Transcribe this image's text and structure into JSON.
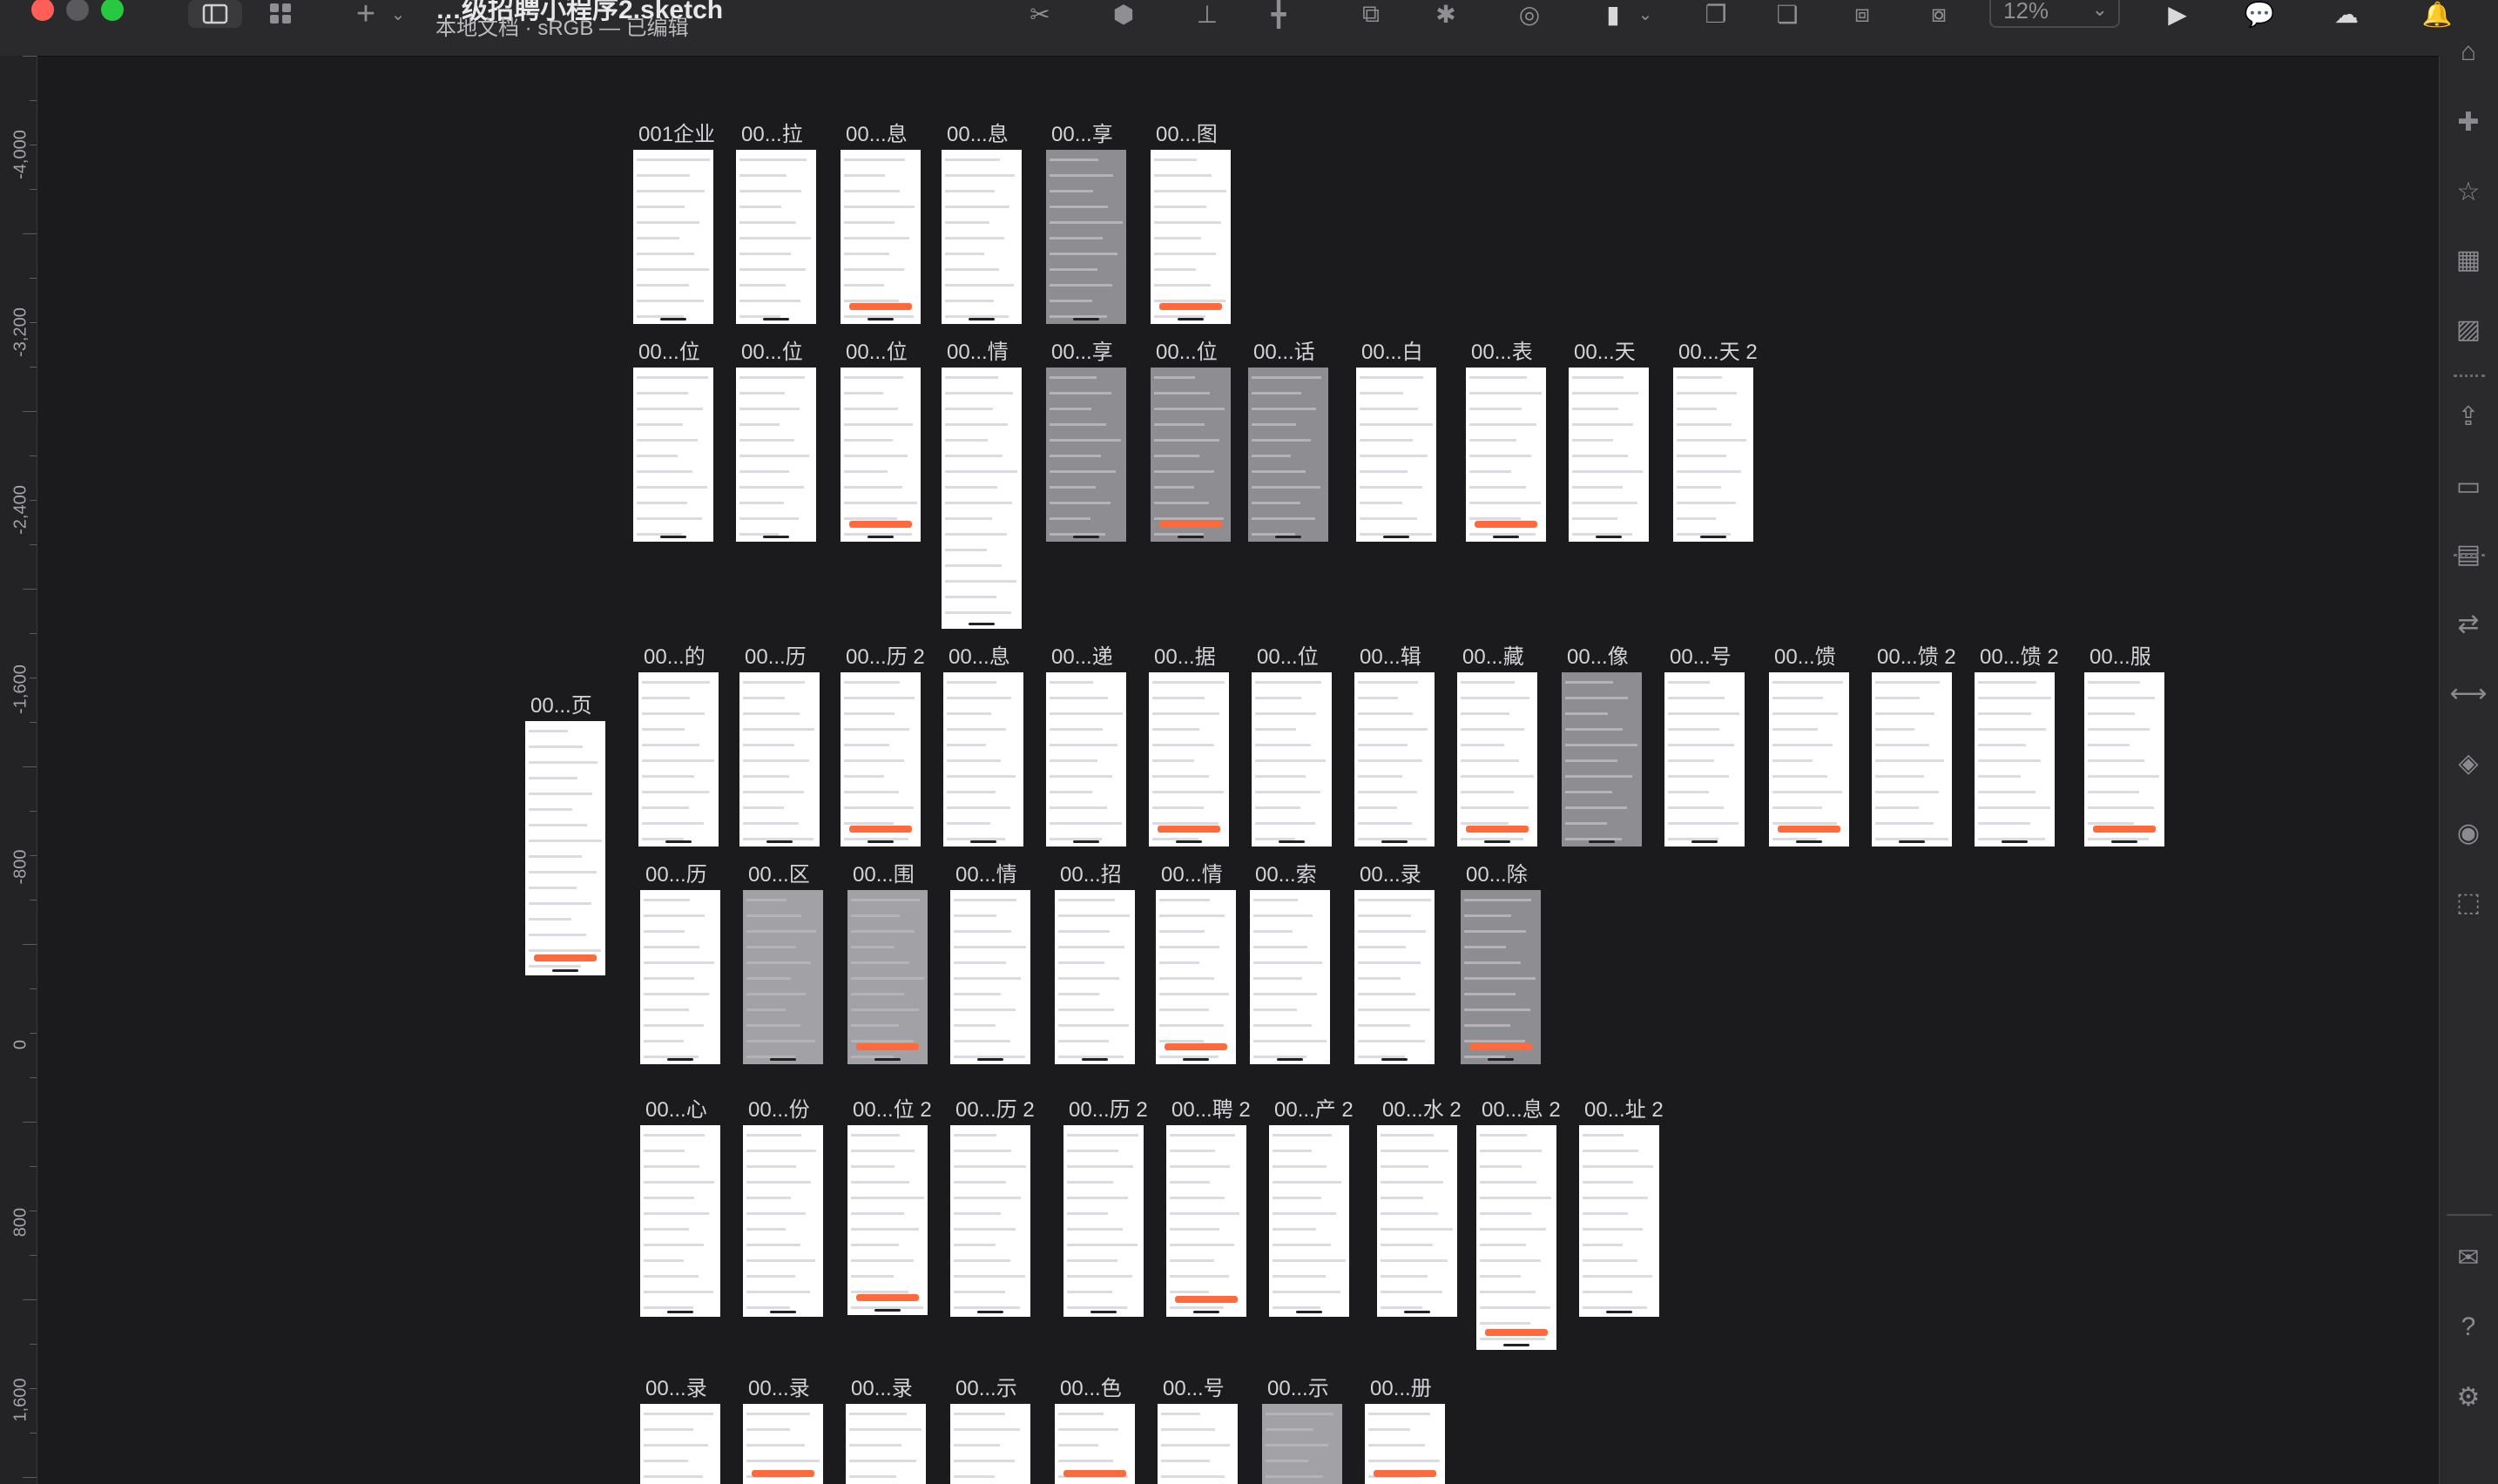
{
  "window": {
    "title": "…级招聘小程序2.sketch",
    "subtitle": "本地文档 · sRGB — 已编辑",
    "zoom_label": "12%"
  },
  "toolbar_icons": [
    "sidebar-toggle-icon",
    "component-grid-icon",
    "insert-icon",
    "chevron-down-icon",
    "scissors-icon",
    "mask-icon",
    "align-icon",
    "distribute-icon",
    "resize-icon",
    "boolean-icon",
    "rotate-icon",
    "flatten-icon",
    "union-icon",
    "subtract-icon",
    "intersect-icon",
    "difference-icon",
    "play-icon",
    "comment-icon",
    "cloud-icon",
    "notification-icon"
  ],
  "ruler_labels": [
    "-4,000",
    "-3,200",
    "-2,400",
    "-1,600",
    "-800",
    "0",
    "800",
    "1,600"
  ],
  "sidebar_icons": [
    "store-icon",
    "puzzle-icon",
    "star-frame-icon",
    "grid-icon",
    "image-icon",
    "export-icon",
    "layout-icon",
    "chart-icon",
    "transfer-icon",
    "resize-horizontal-icon",
    "layers-icon",
    "navigation-icon",
    "export-image-icon",
    "mail-icon",
    "help-icon",
    "settings-icon"
  ],
  "artboards": [
    {
      "name": "001企业",
      "shade": "light",
      "row": 0
    },
    {
      "name": "00...拉",
      "shade": "light",
      "row": 0
    },
    {
      "name": "00...息",
      "shade": "light",
      "row": 0
    },
    {
      "name": "00...息",
      "shade": "light",
      "row": 0
    },
    {
      "name": "00...享",
      "shade": "dark",
      "row": 0
    },
    {
      "name": "00...图",
      "shade": "light",
      "row": 0
    },
    {
      "name": "00...位",
      "shade": "light",
      "row": 1
    },
    {
      "name": "00...位",
      "shade": "light",
      "row": 1
    },
    {
      "name": "00...位",
      "shade": "light",
      "row": 1
    },
    {
      "name": "00...情",
      "shade": "light",
      "row": 1
    },
    {
      "name": "00...享",
      "shade": "dark",
      "row": 1
    },
    {
      "name": "00...位",
      "shade": "dark",
      "row": 1
    },
    {
      "name": "00...话",
      "shade": "dark",
      "row": 1
    },
    {
      "name": "00...白",
      "shade": "light",
      "row": 1
    },
    {
      "name": "00...表",
      "shade": "light",
      "row": 1
    },
    {
      "name": "00...天",
      "shade": "light",
      "row": 1
    },
    {
      "name": "00...天 2",
      "shade": "light",
      "row": 1
    },
    {
      "name": "00...页",
      "shade": "light",
      "row": 2
    },
    {
      "name": "00...的",
      "shade": "light",
      "row": 3
    },
    {
      "name": "00...历",
      "shade": "light",
      "row": 3
    },
    {
      "name": "00...历 2",
      "shade": "light",
      "row": 3
    },
    {
      "name": "00...息",
      "shade": "light",
      "row": 3
    },
    {
      "name": "00...递",
      "shade": "light",
      "row": 3
    },
    {
      "name": "00...据",
      "shade": "light",
      "row": 3
    },
    {
      "name": "00...位",
      "shade": "light",
      "row": 3
    },
    {
      "name": "00...辑",
      "shade": "light",
      "row": 3
    },
    {
      "name": "00...藏",
      "shade": "light",
      "row": 3
    },
    {
      "name": "00...像",
      "shade": "dark",
      "row": 3
    },
    {
      "name": "00...号",
      "shade": "light",
      "row": 3
    },
    {
      "name": "00...馈",
      "shade": "light",
      "row": 3
    },
    {
      "name": "00...馈 2",
      "shade": "light",
      "row": 3
    },
    {
      "name": "00...馈 2",
      "shade": "light",
      "row": 3
    },
    {
      "name": "00...服",
      "shade": "light",
      "row": 3
    },
    {
      "name": "00...历",
      "shade": "light",
      "row": 4
    },
    {
      "name": "00...区",
      "shade": "gray",
      "row": 4
    },
    {
      "name": "00...围",
      "shade": "gray",
      "row": 4
    },
    {
      "name": "00...情",
      "shade": "light",
      "row": 4
    },
    {
      "name": "00...招",
      "shade": "light",
      "row": 4
    },
    {
      "name": "00...情",
      "shade": "light",
      "row": 4
    },
    {
      "name": "00...索",
      "shade": "light",
      "row": 4
    },
    {
      "name": "00...录",
      "shade": "light",
      "row": 4
    },
    {
      "name": "00...除",
      "shade": "dark",
      "row": 4
    },
    {
      "name": "00...心",
      "shade": "light",
      "row": 5
    },
    {
      "name": "00...份",
      "shade": "light",
      "row": 5
    },
    {
      "name": "00...位 2",
      "shade": "light",
      "row": 5
    },
    {
      "name": "00...历 2",
      "shade": "light",
      "row": 5
    },
    {
      "name": "00...历 2",
      "shade": "light",
      "row": 5
    },
    {
      "name": "00...聘 2",
      "shade": "light",
      "row": 5
    },
    {
      "name": "00...产 2",
      "shade": "light",
      "row": 5
    },
    {
      "name": "00...水 2",
      "shade": "light",
      "row": 5
    },
    {
      "name": "00...息 2",
      "shade": "light",
      "row": 5
    },
    {
      "name": "00...址 2",
      "shade": "light",
      "row": 5
    },
    {
      "name": "00...录",
      "shade": "light",
      "row": 6
    },
    {
      "name": "00...录",
      "shade": "light",
      "row": 6
    },
    {
      "name": "00...录",
      "shade": "light",
      "row": 6
    },
    {
      "name": "00...示",
      "shade": "light",
      "row": 6
    },
    {
      "name": "00...色",
      "shade": "light",
      "row": 6
    },
    {
      "name": "00...号",
      "shade": "light",
      "row": 6
    },
    {
      "name": "00...示",
      "shade": "gray",
      "row": 6
    },
    {
      "name": "00...册",
      "shade": "light",
      "row": 6
    }
  ],
  "colors": {
    "accent": "#ff6a3d",
    "canvas": "#1b1b1d",
    "chrome": "#2a2a2c"
  }
}
